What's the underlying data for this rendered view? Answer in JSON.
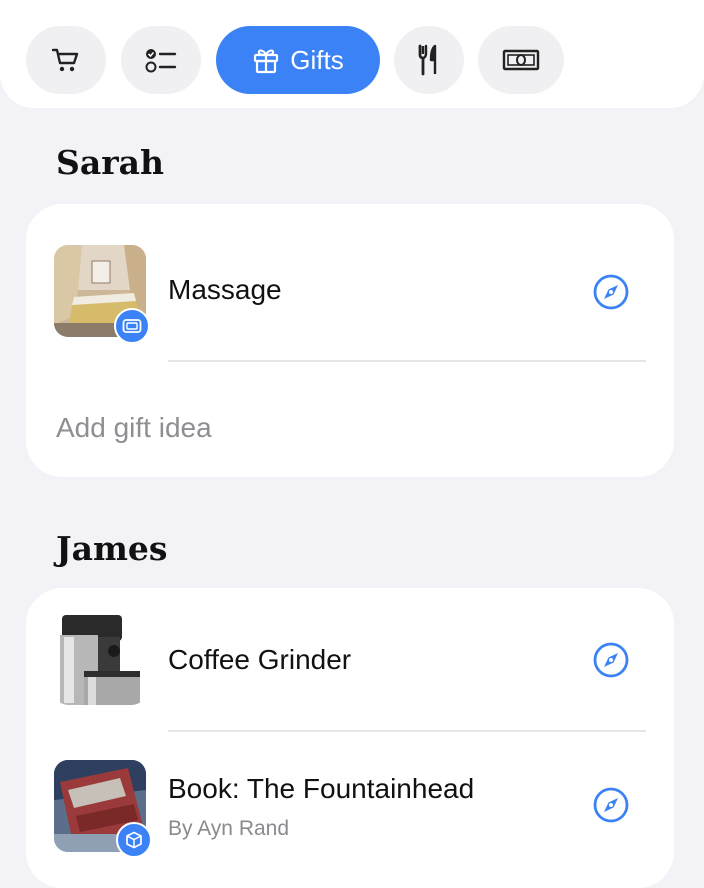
{
  "toolbar": {
    "items": [
      {
        "icon": "cart-icon",
        "label": ""
      },
      {
        "icon": "checklist-icon",
        "label": ""
      },
      {
        "icon": "gift-icon",
        "label": "Gifts",
        "active": true
      },
      {
        "icon": "fork-knife-icon",
        "label": ""
      },
      {
        "icon": "banknote-icon",
        "label": ""
      }
    ],
    "accent": "#3b82f6"
  },
  "sections": [
    {
      "name": "Sarah",
      "items": [
        {
          "title": "Massage",
          "subtitle": "",
          "thumb": "bedroom-photo",
          "badge": "ticket-icon",
          "action": "compass-icon"
        }
      ],
      "add_placeholder": "Add gift idea"
    },
    {
      "name": "James",
      "items": [
        {
          "title": "Coffee Grinder",
          "subtitle": "",
          "thumb": "coffee-grinder-photo",
          "badge": "",
          "action": "compass-icon"
        },
        {
          "title": "Book: The Fountainhead",
          "subtitle": "By Ayn Rand",
          "thumb": "book-cover-photo",
          "badge": "box-icon",
          "action": "compass-icon"
        }
      ]
    }
  ]
}
